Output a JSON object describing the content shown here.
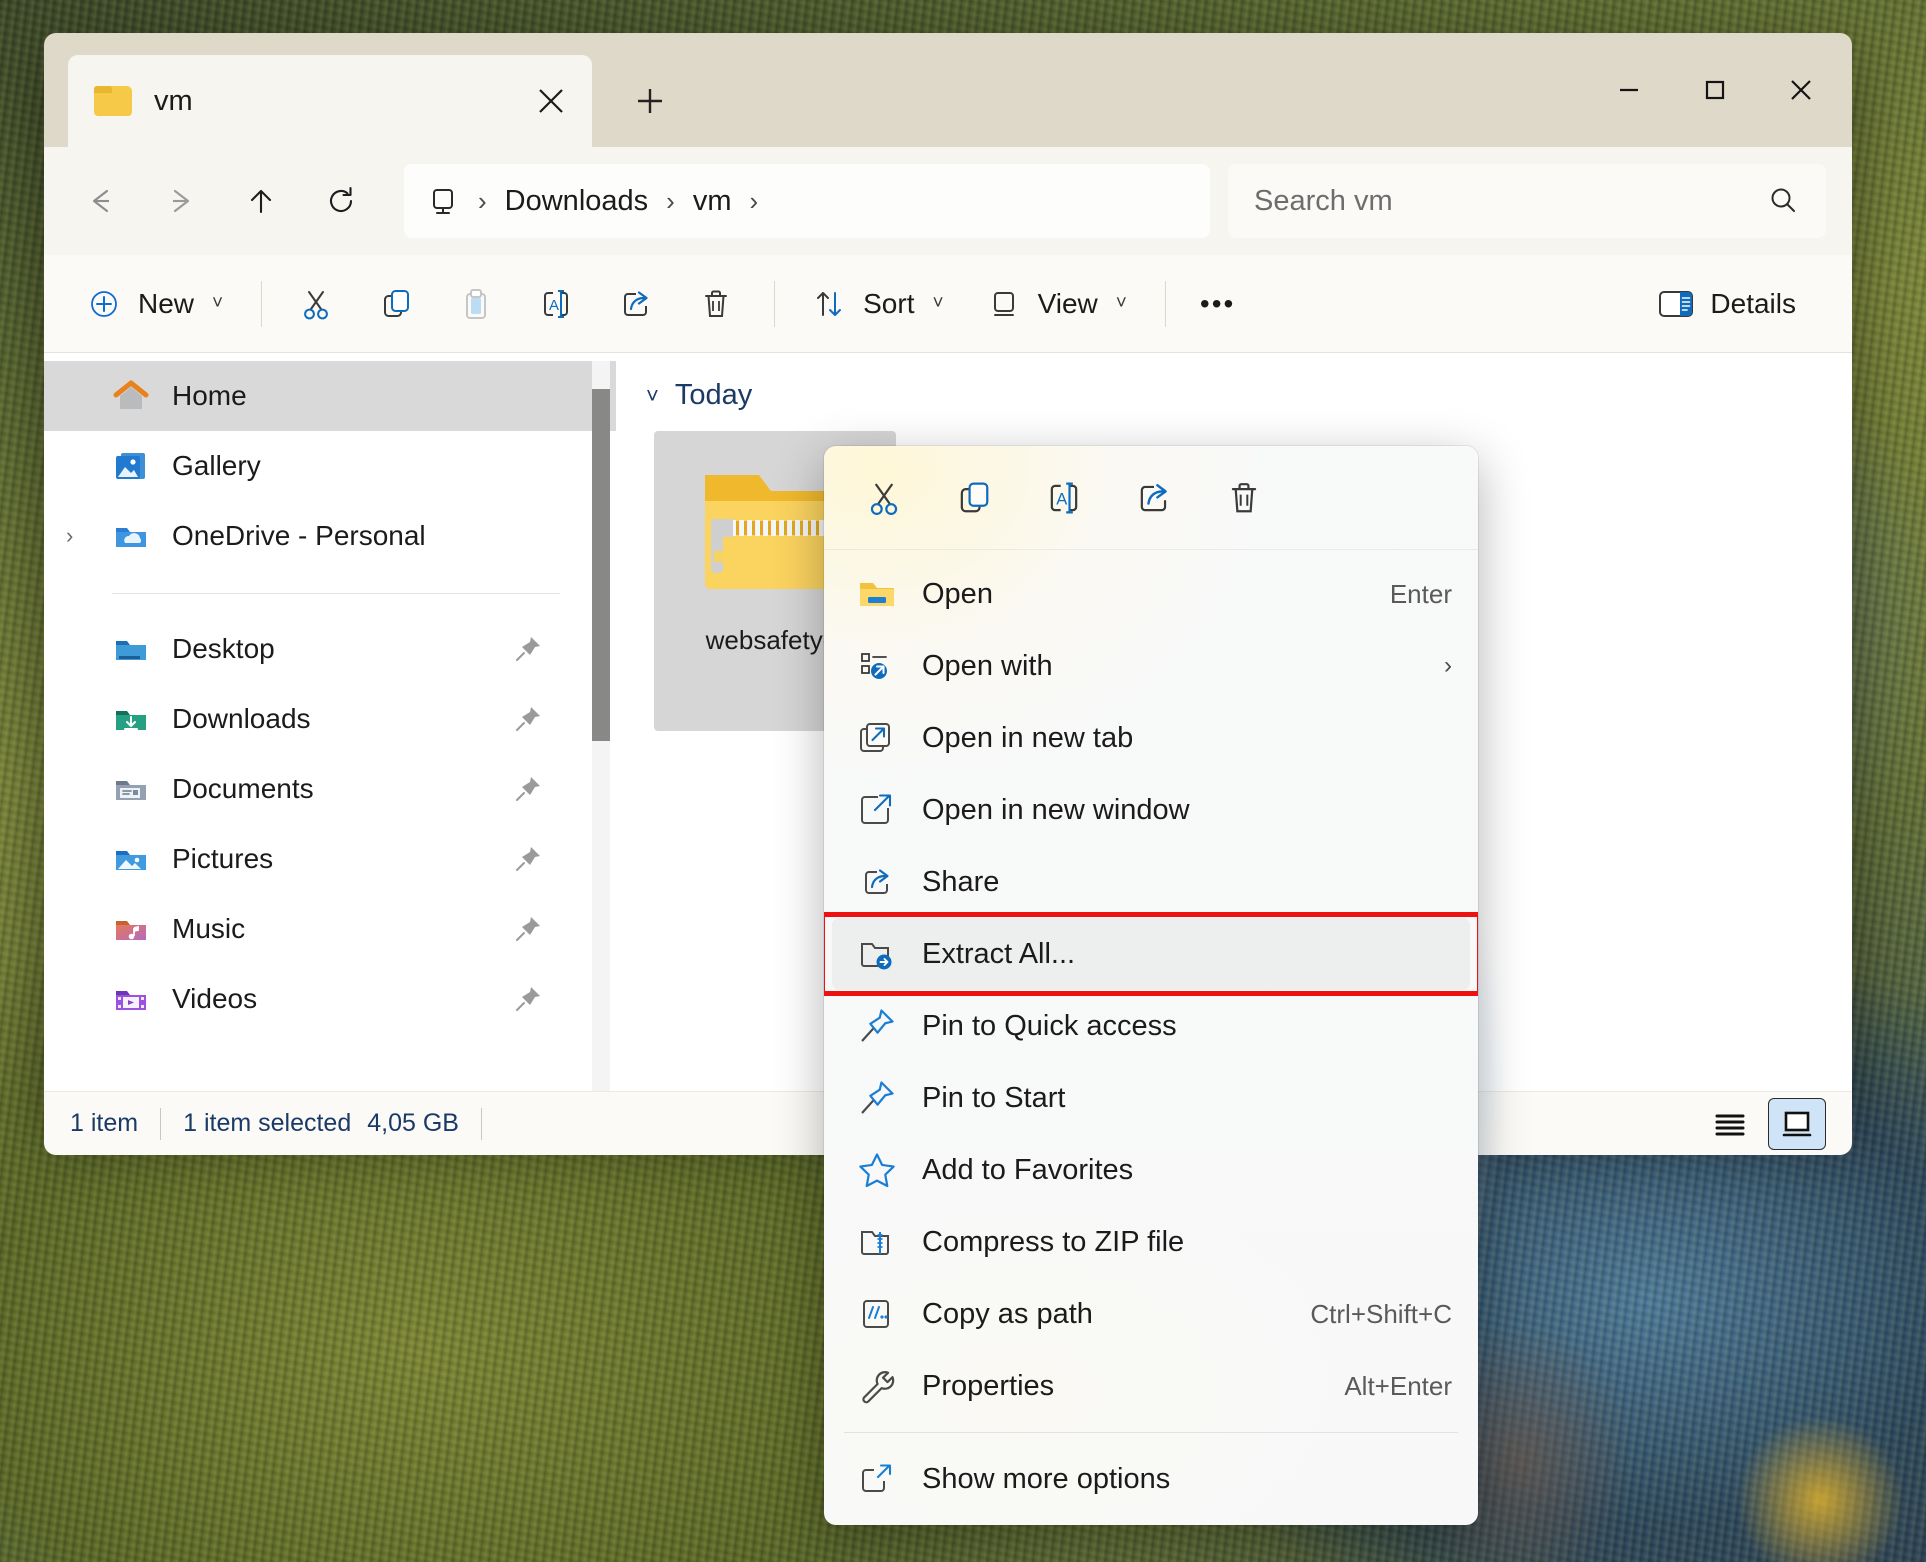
{
  "window": {
    "tab": {
      "label": "vm",
      "icon": "folder-icon",
      "close_icon": "close-icon"
    },
    "new_tab_icon": "plus-icon",
    "controls": {
      "minimize": "minimize-icon",
      "maximize": "maximize-icon",
      "close": "close-icon"
    }
  },
  "nav": {
    "back_icon": "arrow-left-icon",
    "forward_icon": "arrow-right-icon",
    "up_icon": "arrow-up-icon",
    "refresh_icon": "refresh-icon",
    "breadcrumbs": [
      "Downloads",
      "vm"
    ],
    "this_pc_icon": "this-pc-icon",
    "search": {
      "placeholder": "Search vm",
      "icon": "search-icon"
    }
  },
  "commandbar": {
    "new_label": "New",
    "cut_icon": "scissors-icon",
    "copy_icon": "copy-icon",
    "paste_icon": "paste-icon",
    "rename_icon": "rename-icon",
    "share_icon": "share-icon",
    "delete_icon": "trash-icon",
    "sort_label": "Sort",
    "view_label": "View",
    "more_label": "•••",
    "details_label": "Details"
  },
  "sidebar": {
    "top_items": [
      {
        "label": "Home",
        "icon": "home-icon",
        "selected": true,
        "pinned": false,
        "expandable": false
      },
      {
        "label": "Gallery",
        "icon": "gallery-icon",
        "selected": false,
        "pinned": false,
        "expandable": false
      },
      {
        "label": "OneDrive - Personal",
        "icon": "onedrive-icon",
        "selected": false,
        "pinned": false,
        "expandable": true
      }
    ],
    "pinned_items": [
      {
        "label": "Desktop",
        "icon": "desktop-folder-icon",
        "pinned": true
      },
      {
        "label": "Downloads",
        "icon": "downloads-folder-icon",
        "pinned": true
      },
      {
        "label": "Documents",
        "icon": "documents-folder-icon",
        "pinned": true
      },
      {
        "label": "Pictures",
        "icon": "pictures-folder-icon",
        "pinned": true
      },
      {
        "label": "Music",
        "icon": "music-folder-icon",
        "pinned": true
      },
      {
        "label": "Videos",
        "icon": "videos-folder-icon",
        "pinned": true
      }
    ]
  },
  "content": {
    "group_header": "Today",
    "file": {
      "name": "websafety-v",
      "icon": "zip-folder-icon",
      "selected": true
    }
  },
  "statusbar": {
    "item_count": "1 item",
    "selection": "1 item selected",
    "size": "4,05 GB",
    "list_view_icon": "list-view-icon",
    "tile_view_icon": "tile-view-icon"
  },
  "context_menu": {
    "toolbar": [
      {
        "icon": "scissors-icon",
        "name": "cut"
      },
      {
        "icon": "copy-icon",
        "name": "copy"
      },
      {
        "icon": "rename-icon",
        "name": "rename"
      },
      {
        "icon": "share-icon",
        "name": "share"
      },
      {
        "icon": "trash-icon",
        "name": "delete"
      }
    ],
    "items": [
      {
        "label": "Open",
        "icon": "folder-open-icon",
        "accel": "Enter",
        "submenu": false,
        "highlight": false
      },
      {
        "label": "Open with",
        "icon": "open-with-icon",
        "accel": "",
        "submenu": true,
        "highlight": false
      },
      {
        "label": "Open in new tab",
        "icon": "new-tab-icon",
        "accel": "",
        "submenu": false,
        "highlight": false
      },
      {
        "label": "Open in new window",
        "icon": "new-window-icon",
        "accel": "",
        "submenu": false,
        "highlight": false
      },
      {
        "label": "Share",
        "icon": "share-icon",
        "accel": "",
        "submenu": false,
        "highlight": false
      },
      {
        "label": "Extract All...",
        "icon": "extract-all-icon",
        "accel": "",
        "submenu": false,
        "highlight": true
      },
      {
        "label": "Pin to Quick access",
        "icon": "pin-icon",
        "accel": "",
        "submenu": false,
        "highlight": false
      },
      {
        "label": "Pin to Start",
        "icon": "pin-icon",
        "accel": "",
        "submenu": false,
        "highlight": false
      },
      {
        "label": "Add to Favorites",
        "icon": "star-icon",
        "accel": "",
        "submenu": false,
        "highlight": false
      },
      {
        "label": "Compress to ZIP file",
        "icon": "zip-compress-icon",
        "accel": "",
        "submenu": false,
        "highlight": false
      },
      {
        "label": "Copy as path",
        "icon": "copy-path-icon",
        "accel": "Ctrl+Shift+C",
        "submenu": false,
        "highlight": false
      },
      {
        "label": "Properties",
        "icon": "wrench-icon",
        "accel": "Alt+Enter",
        "submenu": false,
        "highlight": false
      },
      {
        "label": "Show more options",
        "icon": "show-more-icon",
        "accel": "",
        "submenu": false,
        "highlight": false
      }
    ],
    "divider_before_index": 12,
    "highlight_color": "#ee1111"
  }
}
